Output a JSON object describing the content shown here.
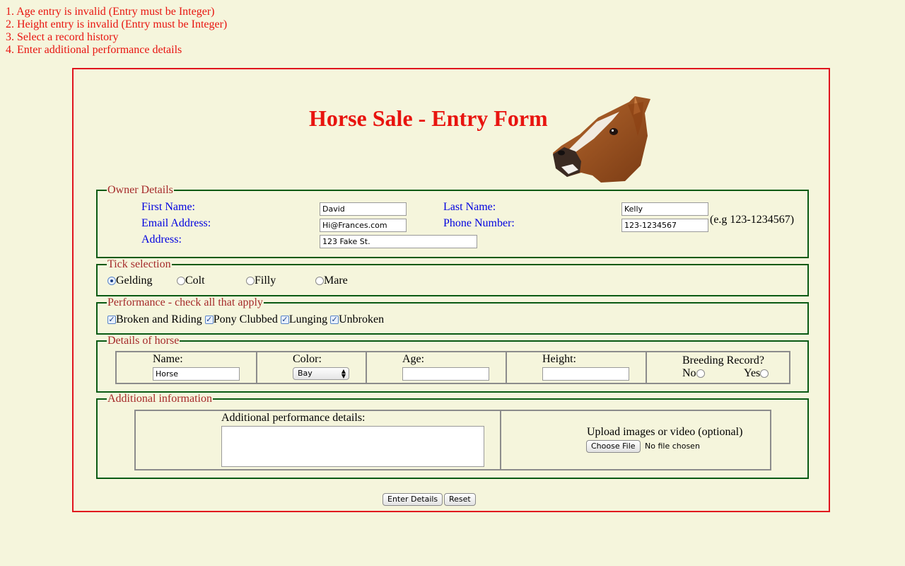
{
  "errors": [
    "1. Age entry is invalid (Entry must be Integer)",
    "2. Height entry is invalid (Entry must be Integer)",
    "3. Select a record history",
    "4. Enter additional performance details"
  ],
  "form": {
    "title": "Horse Sale - Entry Form"
  },
  "owner": {
    "legend": "Owner Details",
    "first_name_label": "First Name:",
    "first_name_value": "David",
    "last_name_label": "Last Name:",
    "last_name_value": "Kelly",
    "email_label": "Email Address:",
    "email_value": "Hi@Frances.com",
    "phone_label": "Phone Number:",
    "phone_value": "123-1234567",
    "phone_hint": "(e.g 123-1234567)",
    "address_label": "Address:",
    "address_value": "123 Fake St."
  },
  "tick": {
    "legend": "Tick selection",
    "options": [
      "Gelding",
      "Colt",
      "Filly",
      "Mare"
    ],
    "selected": "Gelding"
  },
  "performance": {
    "legend": "Performance - check all that apply",
    "options": [
      "Broken and Riding",
      "Pony Clubbed",
      "Lunging",
      "Unbroken"
    ]
  },
  "horse_details": {
    "legend": "Details of horse",
    "name_label": "Name:",
    "name_value": "Horse",
    "color_label": "Color:",
    "color_value": "Bay",
    "age_label": "Age:",
    "age_value": "",
    "height_label": "Height:",
    "height_value": "",
    "breeding_label": "Breeding Record?",
    "breeding_no": "No",
    "breeding_yes": "Yes"
  },
  "additional": {
    "legend": "Additional information",
    "details_label": "Additional performance details:",
    "upload_label": "Upload images or video (optional)",
    "choose_file": "Choose File",
    "no_file": "No file chosen"
  },
  "buttons": {
    "submit": "Enter Details",
    "reset": "Reset"
  }
}
